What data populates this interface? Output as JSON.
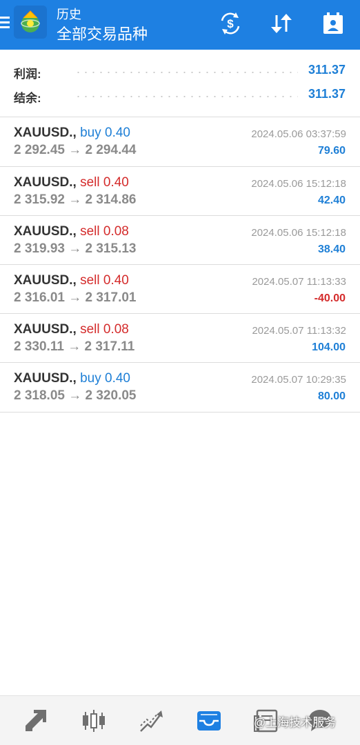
{
  "header": {
    "title_small": "历史",
    "title_main": "全部交易品种",
    "icons": [
      "menu-icon",
      "mt-logo-icon",
      "dollar-cycle-icon",
      "sort-icon",
      "calendar-icon"
    ],
    "accent_color": "#1e80e2"
  },
  "summary": {
    "profit_label": "利润:",
    "profit_value": "311.37",
    "balance_label": "结余:",
    "balance_value": "311.37"
  },
  "deals": [
    {
      "symbol": "XAUUSD.,",
      "side": "buy",
      "volume": "0.40",
      "prices": "2 292.45 → 2 294.44",
      "time": "2024.05.06 03:37:59",
      "profit": "79.60"
    },
    {
      "symbol": "XAUUSD.,",
      "side": "sell",
      "volume": "0.40",
      "prices": "2 315.92 → 2 314.86",
      "time": "2024.05.06 15:12:18",
      "profit": "42.40"
    },
    {
      "symbol": "XAUUSD.,",
      "side": "sell",
      "volume": "0.08",
      "prices": "2 319.93 → 2 315.13",
      "time": "2024.05.06 15:12:18",
      "profit": "38.40"
    },
    {
      "symbol": "XAUUSD.,",
      "side": "sell",
      "volume": "0.40",
      "prices": "2 316.01 → 2 317.01",
      "time": "2024.05.07 11:13:33",
      "profit": "-40.00"
    },
    {
      "symbol": "XAUUSD.,",
      "side": "sell",
      "volume": "0.08",
      "prices": "2 330.11 → 2 317.11",
      "time": "2024.05.07 11:13:32",
      "profit": "104.00"
    },
    {
      "symbol": "XAUUSD.,",
      "side": "buy",
      "volume": "0.40",
      "prices": "2 318.05 → 2 320.05",
      "time": "2024.05.07 10:29:35",
      "profit": "80.00"
    }
  ],
  "colors": {
    "buy": "#1e7fd6",
    "sell": "#d42b2b",
    "positive": "#1e7fd6",
    "negative": "#d42b2b"
  },
  "bottom_nav": {
    "items": [
      "quotes-icon",
      "chart-icon",
      "trade-icon",
      "history-icon",
      "news-icon",
      "chat-icon"
    ],
    "active": "history-icon",
    "watermark": "@上海技术服务"
  }
}
